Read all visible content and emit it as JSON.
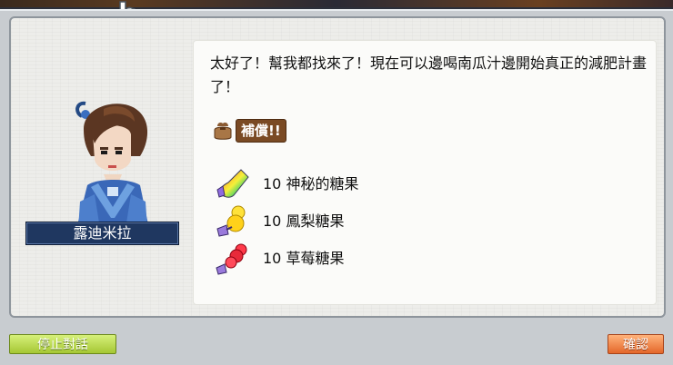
{
  "npc": {
    "name": "露迪米拉"
  },
  "dialog": {
    "message": "太好了！幫我都找來了！現在可以邊喝南瓜汁邊開始真正的減肥計畫了！"
  },
  "reward": {
    "label": "補償!!",
    "items": [
      {
        "quantity": "10",
        "name": "神秘的糖果",
        "icon": "rainbow-candy-icon"
      },
      {
        "quantity": "10",
        "name": "鳳梨糖果",
        "icon": "pineapple-candy-icon"
      },
      {
        "quantity": "10",
        "name": "草莓糖果",
        "icon": "strawberry-candy-icon"
      }
    ]
  },
  "buttons": {
    "stop_conversation": "停止對話",
    "confirm": "確認"
  },
  "colors": {
    "nameplate": "#1f3760",
    "stop_button": "#a5c734",
    "confirm_button": "#e4672a",
    "reward_label_bg": "#7a4a24"
  }
}
